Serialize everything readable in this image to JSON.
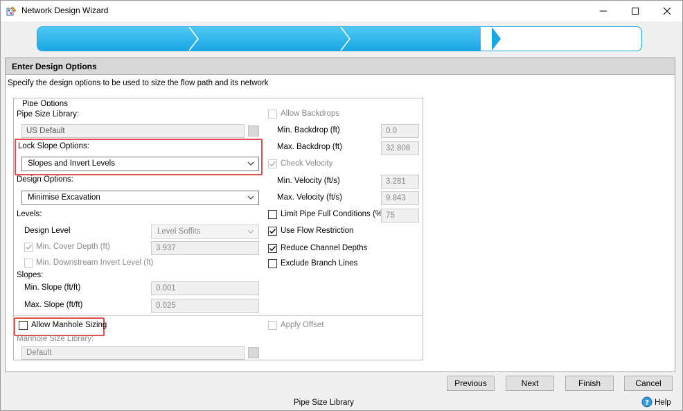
{
  "window": {
    "title": "Network Design Wizard",
    "icon": "wizard-app-icon",
    "controls": [
      "minimize-icon",
      "maximize-icon",
      "close-icon"
    ]
  },
  "wizard_progress": {
    "total_steps": 4,
    "completed_steps": 3,
    "completed_color": "#29b6ec",
    "remaining_color": "#ffffff"
  },
  "panel": {
    "title": "Enter Design Options",
    "description": "Specify the design options to be used to size the flow path and its network"
  },
  "pipe_options": {
    "legend": "Pipe Options",
    "pipe_size_library_label": "Pipe Size Library:",
    "pipe_size_library_value": "US Default",
    "lock_slope_label": "Lock Slope Options:",
    "lock_slope_value": "Slopes and Invert Levels",
    "design_options_label": "Design Options:",
    "design_options_value": "Minimise Excavation",
    "levels_label": "Levels:",
    "design_level_label": "Design Level",
    "design_level_value": "Level Soffits",
    "min_cover_label": "Min. Cover Depth (ft)",
    "min_cover_value": "3.937",
    "min_cover_checked": true,
    "min_downstream_label": "Min. Downstream Invert Level (ft)",
    "min_downstream_checked": false,
    "slopes_label": "Slopes:",
    "min_slope_label": "Min. Slope (ft/ft)",
    "min_slope_value": "0.001",
    "max_slope_label": "Max. Slope (ft/ft)",
    "max_slope_value": "0.025"
  },
  "right_options": {
    "allow_backdrops_label": "Allow Backdrops",
    "allow_backdrops_checked": false,
    "min_backdrop_label": "Min. Backdrop (ft)",
    "min_backdrop_value": "0.0",
    "max_backdrop_label": "Max. Backdrop (ft)",
    "max_backdrop_value": "32.808",
    "check_velocity_label": "Check Velocity",
    "check_velocity_checked": true,
    "min_velocity_label": "Min. Velocity (ft/s)",
    "min_velocity_value": "3.281",
    "max_velocity_label": "Max. Velocity (ft/s)",
    "max_velocity_value": "9.843",
    "limit_pipe_full_label": "Limit Pipe Full Conditions (%)",
    "limit_pipe_full_checked": false,
    "limit_pipe_full_value": "75",
    "use_flow_restriction_label": "Use Flow Restriction",
    "use_flow_restriction_checked": true,
    "reduce_channel_label": "Reduce Channel Depths",
    "reduce_channel_checked": true,
    "exclude_branch_label": "Exclude Branch Lines",
    "exclude_branch_checked": false
  },
  "manhole": {
    "allow_manhole_label": "Allow Manhole Sizing",
    "allow_manhole_checked": false,
    "apply_offset_label": "Apply Offset",
    "apply_offset_checked": false,
    "manhole_library_label": "Manhole Size Library:",
    "manhole_library_value": "Default"
  },
  "buttons": {
    "previous": "Previous",
    "next": "Next",
    "finish": "Finish",
    "cancel": "Cancel"
  },
  "status": {
    "text": "Pipe Size Library",
    "help_label": "Help"
  },
  "colors": {
    "accent": "#1ba1e2",
    "highlight": "#e05050"
  }
}
